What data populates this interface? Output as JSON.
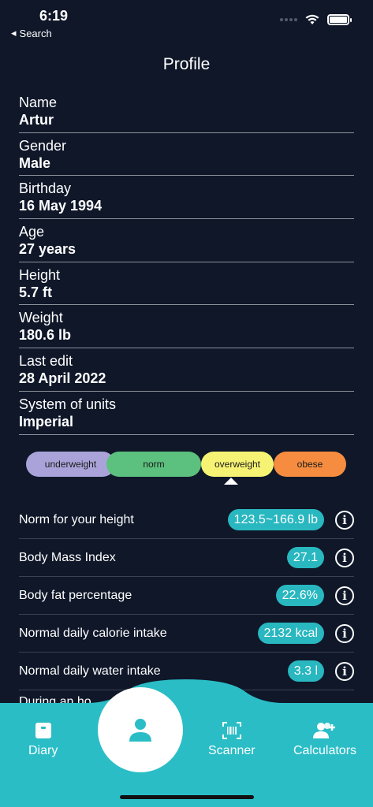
{
  "status": {
    "time": "6:19",
    "back_label": "Search"
  },
  "page_title": "Profile",
  "profile": [
    {
      "label": "Name",
      "value": "Artur"
    },
    {
      "label": "Gender",
      "value": "Male"
    },
    {
      "label": "Birthday",
      "value": "16 May 1994"
    },
    {
      "label": "Age",
      "value": "27 years"
    },
    {
      "label": "Height",
      "value": "5.7 ft"
    },
    {
      "label": "Weight",
      "value": "180.6 lb"
    },
    {
      "label": "Last edit",
      "value": "28 April 2022"
    },
    {
      "label": "System of units",
      "value": "Imperial"
    }
  ],
  "bmi_scale": {
    "segments": [
      "underweight",
      "norm",
      "overweight",
      "obese"
    ],
    "selected": "overweight",
    "colors": {
      "underweight": "#a9a3d9",
      "norm": "#5cc07e",
      "overweight": "#f6f374",
      "obese": "#f58c3f"
    }
  },
  "metrics": [
    {
      "label": "Norm for your height",
      "value": "123.5~166.9 lb"
    },
    {
      "label": "Body Mass Index",
      "value": "27.1"
    },
    {
      "label": "Body fat percentage",
      "value": "22.6%"
    },
    {
      "label": "Normal daily calorie intake",
      "value": "2132 kcal"
    },
    {
      "label": "Normal daily water intake",
      "value": "3.3 l"
    },
    {
      "label": "During an ho",
      "value": ""
    }
  ],
  "tabs": {
    "diary": "Diary",
    "scanner": "Scanner",
    "calculators": "Calculators"
  },
  "colors": {
    "background": "#0f1729",
    "accent": "#2abdc6"
  }
}
